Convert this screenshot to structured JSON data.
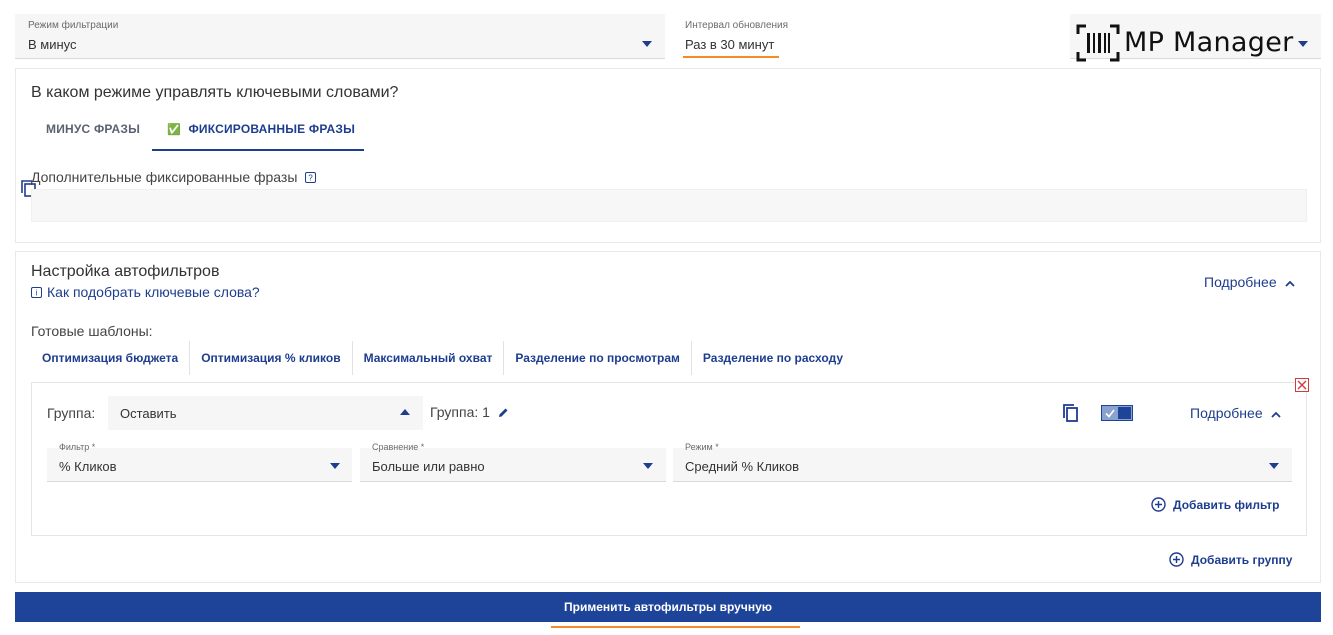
{
  "filter_mode": {
    "label": "Режим фильтрации",
    "value": "В минус"
  },
  "update_interval": {
    "label": "Интервал обновления",
    "value": "Раз в 30 минут"
  },
  "brand": {
    "name": "MP Manager"
  },
  "keywords_section": {
    "title": "В каком режиме управлять ключевыми словами?",
    "tabs": [
      {
        "label": "МИНУС ФРАЗЫ"
      },
      {
        "label": "ФИКСИРОВАННЫЕ ФРАЗЫ",
        "check": "✅"
      }
    ],
    "extra_label": "Дополнительные фиксированные фразы"
  },
  "autofilter": {
    "title": "Настройка автофильтров",
    "help_link": "Как подобрать ключевые слова?",
    "more_label": "Подробнее",
    "templates_label": "Готовые шаблоны:",
    "templates": [
      "Оптимизация бюджета",
      "Оптимизация % кликов",
      "Максимальный охват",
      "Разделение по просмотрам",
      "Разделение по расходу"
    ],
    "group": {
      "label": "Группа:",
      "action_value": "Оставить",
      "name": "Группа: 1",
      "more_label": "Подробнее",
      "filter": {
        "label": "Фильтр *",
        "value": "% Кликов"
      },
      "comparison": {
        "label": "Сравнение *",
        "value": "Больше или равно"
      },
      "mode": {
        "label": "Режим *",
        "value": "Средний % Кликов"
      },
      "add_filter": "Добавить фильтр"
    },
    "add_group": "Добавить группу",
    "apply_button": "Применить автофильтры вручную"
  },
  "colors": {
    "primary": "#1e449a",
    "accent": "#f28c28"
  }
}
